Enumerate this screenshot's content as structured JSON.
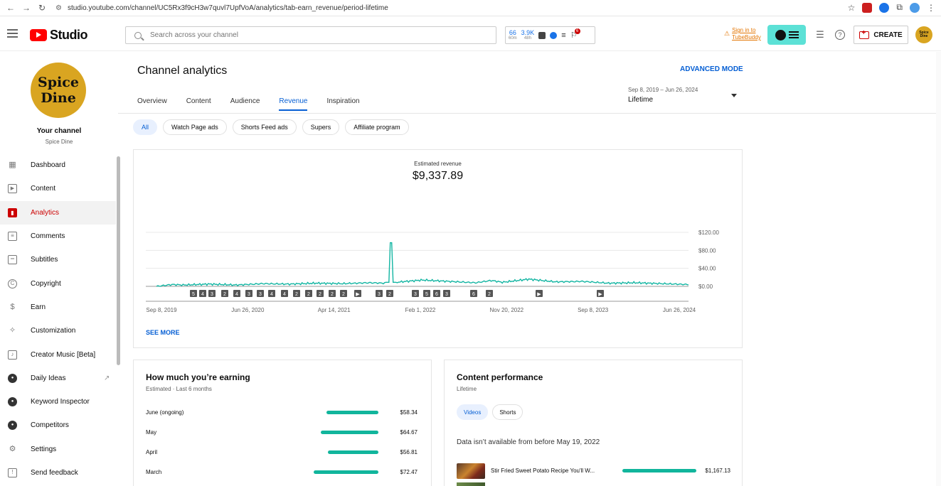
{
  "browser": {
    "url": "studio.youtube.com/channel/UC5Rx3f9cH3w7quvl7UpfVoA/analytics/tab-earn_revenue/period-lifetime"
  },
  "header": {
    "logo_text": "Studio",
    "search_placeholder": "Search across your channel",
    "tubebuddy": {
      "stat1_value": "66",
      "stat1_label": "60m",
      "stat2_value": "3.9K",
      "stat2_label": "48h",
      "badge": "6"
    },
    "signin_line1": "Sign in to",
    "signin_line2": "TubeBuddy",
    "create_label": "CREATE",
    "avatar_text": "Spice Dine"
  },
  "sidebar": {
    "avatar_line1": "Spice",
    "avatar_line2": "Dine",
    "your_channel": "Your channel",
    "channel_name": "Spice Dine",
    "items": [
      {
        "label": "Dashboard",
        "icon": "dashboard-icon"
      },
      {
        "label": "Content",
        "icon": "content-icon"
      },
      {
        "label": "Analytics",
        "icon": "analytics-icon",
        "active": true
      },
      {
        "label": "Comments",
        "icon": "comments-icon"
      },
      {
        "label": "Subtitles",
        "icon": "subtitles-icon"
      },
      {
        "label": "Copyright",
        "icon": "copyright-icon"
      },
      {
        "label": "Earn",
        "icon": "earn-icon"
      },
      {
        "label": "Customization",
        "icon": "customization-icon"
      },
      {
        "label": "Creator Music [Beta]",
        "icon": "creator-music-icon"
      },
      {
        "label": "Daily Ideas",
        "icon": "daily-ideas-icon"
      },
      {
        "label": "Keyword Inspector",
        "icon": "keyword-inspector-icon"
      },
      {
        "label": "Competitors",
        "icon": "competitors-icon"
      },
      {
        "label": "Settings",
        "icon": "settings-icon"
      },
      {
        "label": "Send feedback",
        "icon": "feedback-icon"
      }
    ]
  },
  "main": {
    "title": "Channel analytics",
    "advanced_mode": "ADVANCED MODE",
    "tabs": [
      "Overview",
      "Content",
      "Audience",
      "Revenue",
      "Inspiration"
    ],
    "active_tab": "Revenue",
    "date_range": "Sep 8, 2019 – Jun 26, 2024",
    "date_label": "Lifetime",
    "chips": [
      "All",
      "Watch Page ads",
      "Shorts Feed ads",
      "Supers",
      "Affiliate program"
    ],
    "see_more": "SEE MORE"
  },
  "chart_data": {
    "type": "line",
    "title": "Estimated revenue",
    "total": "$9,337.89",
    "x_ticks": [
      "Sep 8, 2019",
      "Jun 26, 2020",
      "Apr 14, 2021",
      "Feb 1, 2022",
      "Nov 20, 2022",
      "Sep 8, 2023",
      "Jun 26, 2024"
    ],
    "y_ticks": [
      "$0.00",
      "$40.00",
      "$80.00",
      "$120.00"
    ],
    "ylim": [
      0,
      120
    ],
    "markers": [
      "5",
      "4",
      "3",
      "2",
      "4",
      "3",
      "3",
      "4",
      "4",
      "2",
      "2",
      "2",
      "2",
      "2",
      "▶",
      "3",
      "2",
      "3",
      "5",
      "6",
      "3",
      "6",
      "2",
      "▶",
      "▶"
    ],
    "series": [
      {
        "color": "#12b5a2",
        "points": [
          [
            0,
            0
          ],
          [
            0.03,
            4
          ],
          [
            0.05,
            3
          ],
          [
            0.1,
            5
          ],
          [
            0.15,
            3
          ],
          [
            0.2,
            6
          ],
          [
            0.25,
            5
          ],
          [
            0.3,
            7
          ],
          [
            0.35,
            6
          ],
          [
            0.4,
            8
          ],
          [
            0.43,
            7
          ],
          [
            0.44,
            97
          ],
          [
            0.45,
            9
          ],
          [
            0.5,
            14
          ],
          [
            0.55,
            11
          ],
          [
            0.6,
            8
          ],
          [
            0.63,
            13
          ],
          [
            0.65,
            9
          ],
          [
            0.7,
            16
          ],
          [
            0.75,
            10
          ],
          [
            0.8,
            11
          ],
          [
            0.85,
            7
          ],
          [
            0.9,
            8
          ],
          [
            0.95,
            6
          ],
          [
            1,
            4
          ]
        ]
      }
    ]
  },
  "earnings": {
    "title": "How much you’re earning",
    "subtitle": "Estimated · Last 6 months",
    "rows": [
      {
        "label": "June (ongoing)",
        "value": "$58.34",
        "amount": 58.34
      },
      {
        "label": "May",
        "value": "$64.67",
        "amount": 64.67
      },
      {
        "label": "April",
        "value": "$56.81",
        "amount": 56.81
      },
      {
        "label": "March",
        "value": "$72.47",
        "amount": 72.47
      }
    ]
  },
  "performance": {
    "title": "Content performance",
    "subtitle": "Lifetime",
    "chips": [
      "Videos",
      "Shorts"
    ],
    "note": "Data isn’t available from before May 19, 2022",
    "row_title": "Stir Fried Sweet Potato Recipe You'll W...",
    "row_value": "$1,167.13"
  }
}
